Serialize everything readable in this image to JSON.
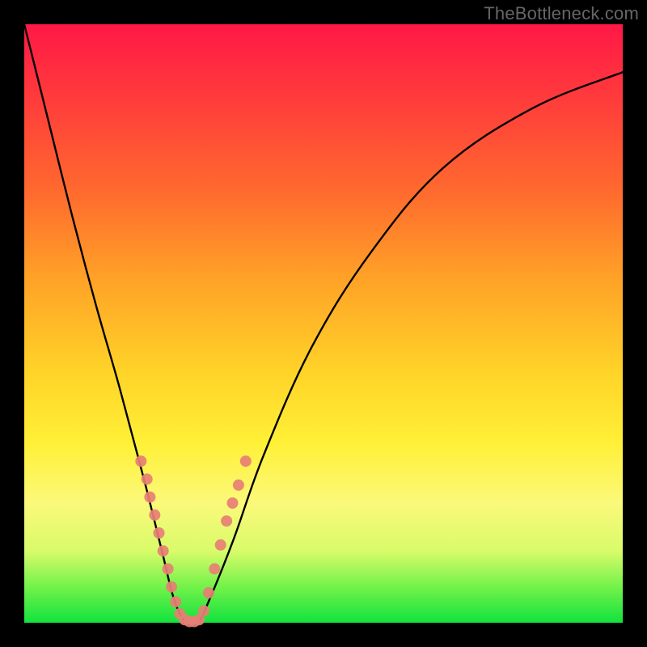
{
  "watermark": "TheBottleneck.com",
  "chart_data": {
    "type": "line",
    "title": "",
    "xlabel": "",
    "ylabel": "",
    "xlim": [
      0,
      100
    ],
    "ylim": [
      0,
      100
    ],
    "annotations": [],
    "series": [
      {
        "name": "bottleneck-curve",
        "x": [
          0,
          4,
          8,
          12,
          16,
          20,
          23,
          25,
          27,
          29,
          31,
          35,
          40,
          48,
          58,
          70,
          85,
          100
        ],
        "y": [
          100,
          84,
          68,
          53,
          39,
          24,
          12,
          4,
          0,
          0,
          4,
          14,
          28,
          46,
          62,
          76,
          86,
          92
        ]
      }
    ],
    "markers": [
      {
        "name": "left-branch-dots",
        "color": "#e77f74",
        "points": [
          {
            "x": 19.5,
            "y": 27
          },
          {
            "x": 20.5,
            "y": 24
          },
          {
            "x": 21.0,
            "y": 21
          },
          {
            "x": 21.8,
            "y": 18
          },
          {
            "x": 22.5,
            "y": 15
          },
          {
            "x": 23.2,
            "y": 12
          },
          {
            "x": 24.0,
            "y": 9
          },
          {
            "x": 24.6,
            "y": 6
          },
          {
            "x": 25.3,
            "y": 3.5
          },
          {
            "x": 26.0,
            "y": 1.5
          }
        ]
      },
      {
        "name": "trough-dots",
        "color": "#e77f74",
        "points": [
          {
            "x": 26.8,
            "y": 0.5
          },
          {
            "x": 27.6,
            "y": 0.2
          },
          {
            "x": 28.4,
            "y": 0.2
          },
          {
            "x": 29.2,
            "y": 0.5
          }
        ]
      },
      {
        "name": "right-branch-dots",
        "color": "#e77f74",
        "points": [
          {
            "x": 30.0,
            "y": 2
          },
          {
            "x": 30.8,
            "y": 5
          },
          {
            "x": 31.8,
            "y": 9
          },
          {
            "x": 32.8,
            "y": 13
          },
          {
            "x": 33.8,
            "y": 17
          },
          {
            "x": 34.8,
            "y": 20
          },
          {
            "x": 35.8,
            "y": 23
          },
          {
            "x": 37.0,
            "y": 27
          }
        ]
      }
    ],
    "gradient_stops": [
      {
        "pos": 0.0,
        "color": "#ff1846"
      },
      {
        "pos": 0.12,
        "color": "#ff3a3c"
      },
      {
        "pos": 0.28,
        "color": "#ff6a2e"
      },
      {
        "pos": 0.42,
        "color": "#ffa027"
      },
      {
        "pos": 0.58,
        "color": "#ffd328"
      },
      {
        "pos": 0.7,
        "color": "#fff037"
      },
      {
        "pos": 0.8,
        "color": "#fbf97a"
      },
      {
        "pos": 0.88,
        "color": "#d9fb6a"
      },
      {
        "pos": 0.94,
        "color": "#73f24a"
      },
      {
        "pos": 1.0,
        "color": "#12e23e"
      }
    ]
  }
}
